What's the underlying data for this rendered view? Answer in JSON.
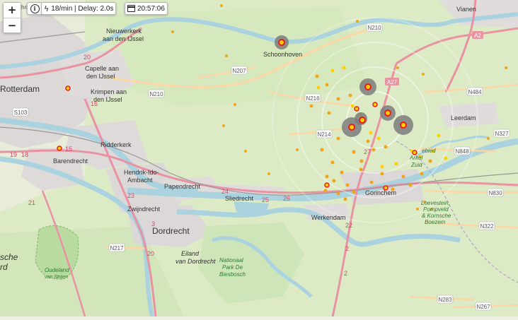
{
  "controls": {
    "zoom_in": "+",
    "zoom_out": "−",
    "info_icon": "i",
    "rate_text": "18/min | Delay: 2.0s",
    "time_text": "20:57:06",
    "behind_label": "hrijv"
  },
  "icons": {
    "zoom": "plus-minus-icons",
    "info": "info-icon",
    "rate": "lightning-bolt-icon",
    "time": "calendar-icon"
  },
  "colors": {
    "land": "#eef0e4",
    "field": "#dcebc6",
    "urban": "#dcd8d8",
    "water": "#aad3df",
    "motorway": "#e892a2",
    "primary": "#fcd6a4",
    "strike_fresh": "#e81b1b",
    "strike_recent": "#ffd000",
    "strike_older": "#f0a51a",
    "cluster": "#7d7d7d"
  },
  "places": {
    "rotterdam": "Rotterdam",
    "capelle": "Capelle aan den IJssel",
    "capelle_l1": "Capelle aan",
    "capelle_l2": "den IJssel",
    "krimpen_l1": "Krimpen aan",
    "krimpen_l2": "den IJssel",
    "nieuwerkerk_l1": "Nieuwerkerk",
    "nieuwerkerk_l2": "aan den IJssel",
    "ridderkerk": "Ridderkerk",
    "barendrecht": "Barendrecht",
    "hendrik_l1": "Hendrik-Ido-",
    "hendrik_l2": "Ambacht",
    "zwijndrecht": "Zwijndrecht",
    "papendrecht": "Papendrecht",
    "dordrecht": "Dordrecht",
    "sliedrecht": "Sliedrecht",
    "werkendam": "Werkendam",
    "gorinchem": "Gorinchem",
    "schoonhoven": "Schoonhoven",
    "vianen": "Vianen",
    "leerdam": "Leerdam",
    "eiland_l1": "Eiland",
    "eiland_l2": "van Dordrecht",
    "np_l1": "Nationaal",
    "np_l2": "Park De",
    "np_l3": "Biesbosch",
    "oudeland_l1": "Oudeland",
    "oudeland_l2": "van Strijen",
    "che": "sche",
    "rd": "rd",
    "loevestein_l1": "Loevestein,",
    "loevestein_l2": "Pompveld",
    "loevestein_l3": "& Kornsche",
    "loevestein_l4": "Boezem",
    "gebied_l1": "ebied",
    "gebied_l2": "Arkel",
    "gebied_l3": "Zuid"
  },
  "roads": {
    "n210a": "N210",
    "n210b": "N210",
    "n207": "N207",
    "n216": "N216",
    "n214": "N214",
    "a27": "A27",
    "a2": "A2",
    "n484": "N484",
    "n327": "N327",
    "n848": "N848",
    "n830": "N830",
    "n322": "N322",
    "n217": "N217",
    "n283": "N283",
    "n267": "N267",
    "s103": "S103",
    "a16": "16",
    "a20": "20",
    "a15": "15",
    "a24": "24",
    "a2b": "2",
    "a27b": "27",
    "a22": "22",
    "a21": "21",
    "a23": "23",
    "a25": "25",
    "a26": "26",
    "a18": "18",
    "a19": "19",
    "a3": "3"
  }
}
